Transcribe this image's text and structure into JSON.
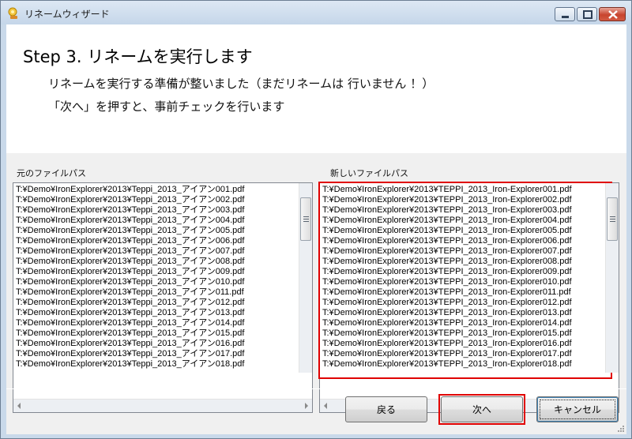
{
  "window": {
    "title": "リネームウィザード"
  },
  "header": {
    "step_title": "Step 3. リネームを実行します",
    "description_1": "リネームを実行する準備が整いました（まだリネームは 行いません ！）",
    "description_2": "「次へ」を押すと、事前チェックを行います"
  },
  "lists": {
    "original_label": "元のファイルパス",
    "new_label": "新しいファイルパス",
    "original_paths": [
      "T:¥Demo¥IronExplorer¥2013¥Teppi_2013_アイアン001.pdf",
      "T:¥Demo¥IronExplorer¥2013¥Teppi_2013_アイアン002.pdf",
      "T:¥Demo¥IronExplorer¥2013¥Teppi_2013_アイアン003.pdf",
      "T:¥Demo¥IronExplorer¥2013¥Teppi_2013_アイアン004.pdf",
      "T:¥Demo¥IronExplorer¥2013¥Teppi_2013_アイアン005.pdf",
      "T:¥Demo¥IronExplorer¥2013¥Teppi_2013_アイアン006.pdf",
      "T:¥Demo¥IronExplorer¥2013¥Teppi_2013_アイアン007.pdf",
      "T:¥Demo¥IronExplorer¥2013¥Teppi_2013_アイアン008.pdf",
      "T:¥Demo¥IronExplorer¥2013¥Teppi_2013_アイアン009.pdf",
      "T:¥Demo¥IronExplorer¥2013¥Teppi_2013_アイアン010.pdf",
      "T:¥Demo¥IronExplorer¥2013¥Teppi_2013_アイアン011.pdf",
      "T:¥Demo¥IronExplorer¥2013¥Teppi_2013_アイアン012.pdf",
      "T:¥Demo¥IronExplorer¥2013¥Teppi_2013_アイアン013.pdf",
      "T:¥Demo¥IronExplorer¥2013¥Teppi_2013_アイアン014.pdf",
      "T:¥Demo¥IronExplorer¥2013¥Teppi_2013_アイアン015.pdf",
      "T:¥Demo¥IronExplorer¥2013¥Teppi_2013_アイアン016.pdf",
      "T:¥Demo¥IronExplorer¥2013¥Teppi_2013_アイアン017.pdf",
      "T:¥Demo¥IronExplorer¥2013¥Teppi_2013_アイアン018.pdf"
    ],
    "new_paths": [
      "T:¥Demo¥IronExplorer¥2013¥TEPPI_2013_Iron-Explorer001.pdf",
      "T:¥Demo¥IronExplorer¥2013¥TEPPI_2013_Iron-Explorer002.pdf",
      "T:¥Demo¥IronExplorer¥2013¥TEPPI_2013_Iron-Explorer003.pdf",
      "T:¥Demo¥IronExplorer¥2013¥TEPPI_2013_Iron-Explorer004.pdf",
      "T:¥Demo¥IronExplorer¥2013¥TEPPI_2013_Iron-Explorer005.pdf",
      "T:¥Demo¥IronExplorer¥2013¥TEPPI_2013_Iron-Explorer006.pdf",
      "T:¥Demo¥IronExplorer¥2013¥TEPPI_2013_Iron-Explorer007.pdf",
      "T:¥Demo¥IronExplorer¥2013¥TEPPI_2013_Iron-Explorer008.pdf",
      "T:¥Demo¥IronExplorer¥2013¥TEPPI_2013_Iron-Explorer009.pdf",
      "T:¥Demo¥IronExplorer¥2013¥TEPPI_2013_Iron-Explorer010.pdf",
      "T:¥Demo¥IronExplorer¥2013¥TEPPI_2013_Iron-Explorer011.pdf",
      "T:¥Demo¥IronExplorer¥2013¥TEPPI_2013_Iron-Explorer012.pdf",
      "T:¥Demo¥IronExplorer¥2013¥TEPPI_2013_Iron-Explorer013.pdf",
      "T:¥Demo¥IronExplorer¥2013¥TEPPI_2013_Iron-Explorer014.pdf",
      "T:¥Demo¥IronExplorer¥2013¥TEPPI_2013_Iron-Explorer015.pdf",
      "T:¥Demo¥IronExplorer¥2013¥TEPPI_2013_Iron-Explorer016.pdf",
      "T:¥Demo¥IronExplorer¥2013¥TEPPI_2013_Iron-Explorer017.pdf",
      "T:¥Demo¥IronExplorer¥2013¥TEPPI_2013_Iron-Explorer018.pdf"
    ]
  },
  "buttons": {
    "back_label": "戻る",
    "next_label": "次へ",
    "cancel_label": "キャンセル"
  },
  "icons": {
    "app": "wizard-app-icon",
    "minimize": "minimize-icon",
    "maximize": "maximize-icon",
    "close": "close-icon"
  },
  "colors": {
    "highlight_frame": "#e00000",
    "title_bar": "#c9d9ea",
    "close_button": "#c8452e"
  }
}
